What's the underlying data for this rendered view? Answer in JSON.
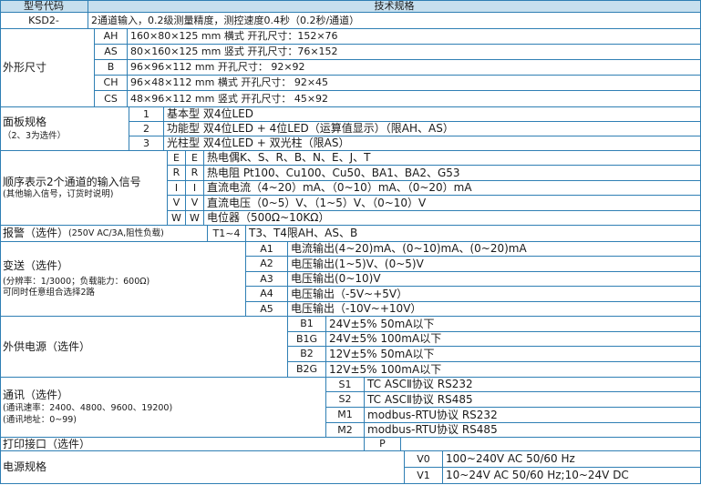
{
  "header": {
    "col1": "型号代码",
    "col2": "技术规格"
  },
  "model": {
    "code": "KSD2-",
    "spec": "2通道输入，0.2级测量精度，测控速度0.4秒（0.2秒/通道）"
  },
  "dimensions": {
    "label": "外形尺寸",
    "rows": [
      {
        "code": "AH",
        "text": "160×80×125 mm 横式      开孔尺寸：152×76"
      },
      {
        "code": "AS",
        "text": " 80×160×125 mm 竖式      开孔尺寸：76×152"
      },
      {
        "code": "B",
        "text": "96×96×112 mm      开孔尺寸：  92×92"
      },
      {
        "code": "CH",
        "text": "96×48×112 mm 横式      开孔尺寸：  92×45"
      },
      {
        "code": "CS",
        "text": "48×96×112 mm 竖式      开孔尺寸：  45×92"
      }
    ]
  },
  "panel": {
    "label": "面板规格",
    "note": "（2、3为选件）",
    "rows": [
      {
        "code": "1",
        "text": "基本型 双4位LED"
      },
      {
        "code": "2",
        "text": "功能型 双4位LED + 4位LED（运算值显示）（限AH、AS）"
      },
      {
        "code": "3",
        "text": "光柱型 双4位LED + 双光柱（限AS）"
      }
    ]
  },
  "input": {
    "label": "顺序表示2个通道的输入信号",
    "note": "(其他输入信号，订货时说明)",
    "rows": [
      {
        "c1": "E",
        "c2": "E",
        "text": "热电偶K、S、R、B、N、E、J、T"
      },
      {
        "c1": "R",
        "c2": "R",
        "text": "热电阻 Pt100、Cu100、Cu50、BA1、BA2、G53"
      },
      {
        "c1": "I",
        "c2": "I",
        "text": "直流电流（4~20）mA、（0~10）mA、（0~20）mA"
      },
      {
        "c1": "V",
        "c2": "V",
        "text": "直流电压（0~5）V、（1~5）V、（0~10）V"
      },
      {
        "c1": "W",
        "c2": "W",
        "text": "电位器（500Ω~10KΩ）"
      }
    ]
  },
  "alarm": {
    "label": "报警（选件）",
    "note": "(250V AC/3A,阻性负载)",
    "code": "T1~4",
    "text": "T3、T4限AH、AS、B"
  },
  "transmit": {
    "label": "变送（选件）",
    "note1": "(分辨率：1/3000；负载能力：600Ω)",
    "note2": "可同时任意组合选择2路",
    "rows": [
      {
        "code": "A1",
        "text": "电流输出(4~20)mA、(0~10)mA、(0~20)mA"
      },
      {
        "code": "A2",
        "text": "电压输出(1~5)V、(0~5)V"
      },
      {
        "code": "A3",
        "text": "电压输出(0~10)V"
      },
      {
        "code": "A4",
        "text": "电压输出（-5V~+5V）"
      },
      {
        "code": "A5",
        "text": "电压输出（-10V~+10V）"
      }
    ]
  },
  "supply": {
    "label": "外供电源（选件）",
    "rows": [
      {
        "code": "B1",
        "text": "24V±5% 50mA以下"
      },
      {
        "code": "B1G",
        "text": "24V±5% 100mA以下"
      },
      {
        "code": "B2",
        "text": "12V±5% 50mA以下"
      },
      {
        "code": "B2G",
        "text": "12V±5% 100mA以下"
      }
    ]
  },
  "comm": {
    "label": "通讯（选件）",
    "note1": "(通讯速率：2400、4800、9600、19200)",
    "note2": "(通讯地址：0~99)",
    "rows": [
      {
        "code": "S1",
        "text": "TC  ASCⅡ协议 RS232"
      },
      {
        "code": "S2",
        "text": "TC  ASCⅡ协议 RS485"
      },
      {
        "code": "M1",
        "text": "modbus-RTU协议 RS232"
      },
      {
        "code": "M2",
        "text": "modbus-RTU协议 RS485"
      }
    ]
  },
  "print": {
    "label": "打印接口（选件）",
    "code": "P"
  },
  "power": {
    "label": "电源规格",
    "rows": [
      {
        "code": "V0",
        "text": "100~240V  AC 50/60 Hz"
      },
      {
        "code": "V1",
        "text": "10~24V  AC 50/60 Hz;10~24V  DC"
      }
    ]
  }
}
